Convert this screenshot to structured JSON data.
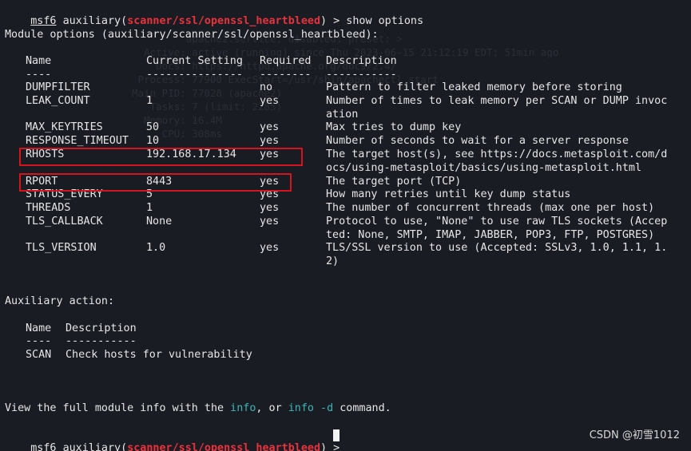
{
  "prompt": {
    "prefix": "msf6",
    "module_word": "auxiliary(",
    "module_path": "scanner/ssl/openssl_heartbleed",
    "close": ")",
    "arrow": " > ",
    "command": "show options"
  },
  "module_options_header": "Module options (auxiliary/scanner/ssl/openssl_heartbleed):",
  "columns": {
    "name": "Name",
    "current_setting": "Current Setting",
    "required": "Required",
    "description": "Description",
    "name_dash": "----",
    "current_dash": "---------------",
    "required_dash": "--------",
    "description_dash": "-----------"
  },
  "options": [
    {
      "name": "DUMPFILTER",
      "value": "",
      "required": "no",
      "desc": [
        "Pattern to filter leaked memory before storing"
      ]
    },
    {
      "name": "LEAK_COUNT",
      "value": "1",
      "required": "yes",
      "desc": [
        "Number of times to leak memory per SCAN or DUMP invoc",
        "ation"
      ]
    },
    {
      "name": "MAX_KEYTRIES",
      "value": "50",
      "required": "yes",
      "desc": [
        "Max tries to dump key"
      ]
    },
    {
      "name": "RESPONSE_TIMEOUT",
      "value": "10",
      "required": "yes",
      "desc": [
        "Number of seconds to wait for a server response"
      ]
    },
    {
      "name": "RHOSTS",
      "value": "192.168.17.134",
      "required": "yes",
      "desc": [
        "The target host(s), see https://docs.metasploit.com/d",
        "ocs/using-metasploit/basics/using-metasploit.html"
      ]
    },
    {
      "name": "RPORT",
      "value": "8443",
      "required": "yes",
      "desc": [
        "The target port (TCP)"
      ]
    },
    {
      "name": "STATUS_EVERY",
      "value": "5",
      "required": "yes",
      "desc": [
        "How many retries until key dump status"
      ]
    },
    {
      "name": "THREADS",
      "value": "1",
      "required": "yes",
      "desc": [
        "The number of concurrent threads (max one per host)"
      ]
    },
    {
      "name": "TLS_CALLBACK",
      "value": "None",
      "required": "yes",
      "desc": [
        "Protocol to use, \"None\" to use raw TLS sockets (Accep",
        "ted: None, SMTP, IMAP, JABBER, POP3, FTP, POSTGRES)"
      ]
    },
    {
      "name": "TLS_VERSION",
      "value": "1.0",
      "required": "yes",
      "desc": [
        "TLS/SSL version to use (Accepted: SSLv3, 1.0, 1.1, 1.",
        "2)"
      ]
    }
  ],
  "aux_action_header": "Auxiliary action:",
  "actions": {
    "name_header": "Name",
    "desc_header": "Description",
    "name_dash": "----",
    "desc_dash": "-----------",
    "rows": [
      {
        "name": "SCAN",
        "desc": "Check hosts for vulnerability"
      }
    ]
  },
  "footer": {
    "part1": "View the full module info with the ",
    "info": "info",
    "part2": ", or ",
    "info_d": "info -d",
    "part3": " command."
  },
  "watermark": "CSDN @初雪1012",
  "colors": {
    "background": "#1a1c23",
    "text": "#e6e6e6",
    "module_path": "#e8323c",
    "command_highlight": "#38b6b6",
    "highlight_box": "#d4141e"
  }
}
